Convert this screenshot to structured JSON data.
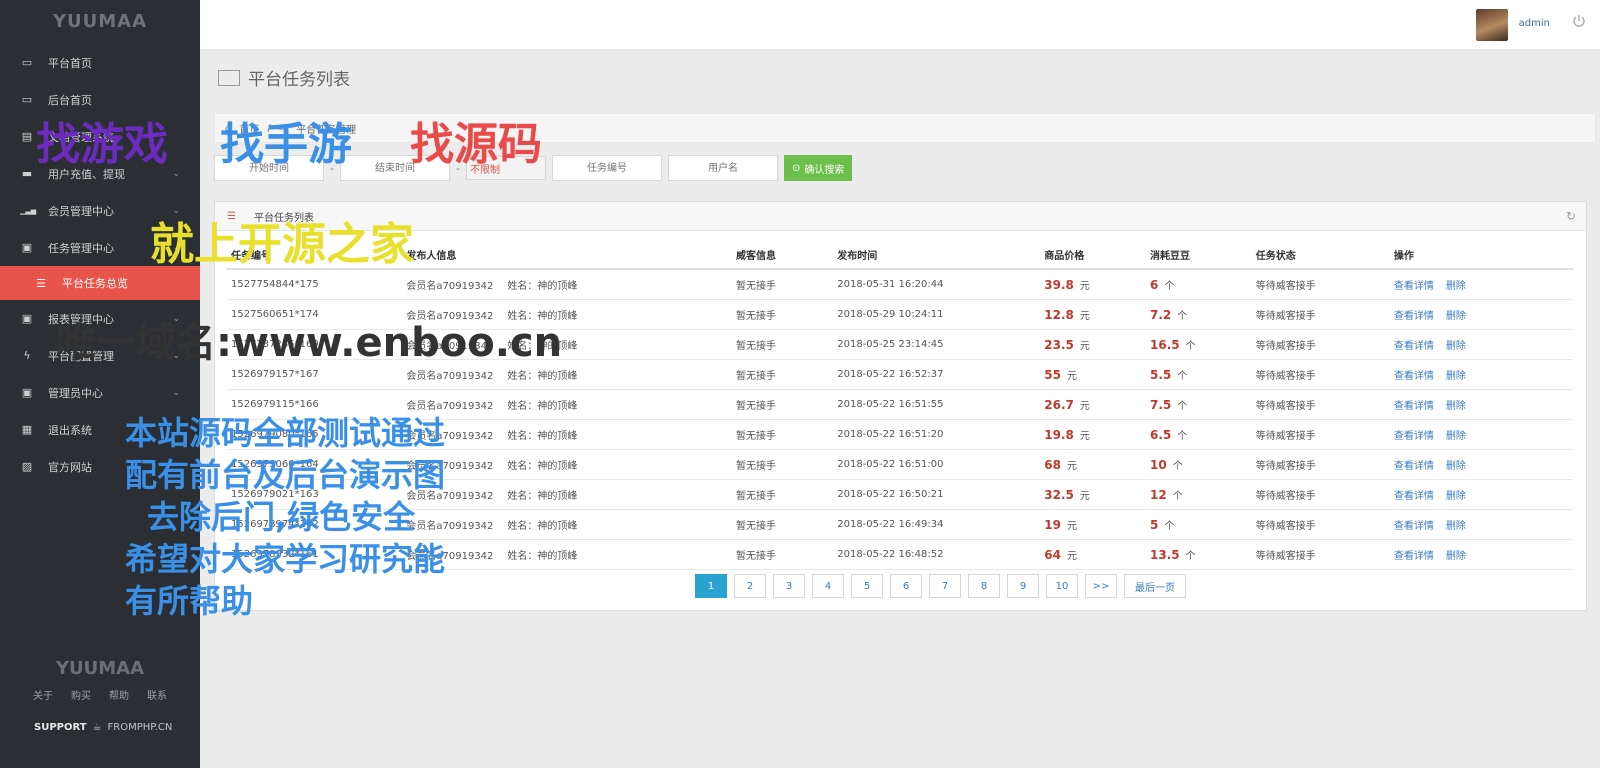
{
  "sidebar": {
    "brand": "YUUMAA",
    "items": [
      {
        "label": "平台首页",
        "icon": "laptop-icon"
      },
      {
        "label": "后台首页",
        "icon": "laptop-icon"
      },
      {
        "label": "文档管理系统",
        "icon": "doc-icon"
      },
      {
        "label": "用户充值、提现",
        "icon": "card-icon"
      },
      {
        "label": "会员管理中心",
        "icon": "signal-icon"
      },
      {
        "label": "任务管理中心",
        "icon": "briefcase-icon"
      },
      {
        "label": "平台任务总览",
        "icon": "list-icon",
        "active": true
      },
      {
        "label": "报表管理中心",
        "icon": "briefcase-icon"
      },
      {
        "label": "平台配置管理",
        "icon": "bolt-icon"
      },
      {
        "label": "管理员中心",
        "icon": "briefcase-icon"
      },
      {
        "label": "退出系统",
        "icon": "calendar-icon"
      },
      {
        "label": "官方网站",
        "icon": "image-icon"
      }
    ],
    "footer": {
      "brand": "YUUMAA",
      "links": [
        "关于",
        "购买",
        "帮助",
        "联系"
      ],
      "support_label": "SUPPORT",
      "support_site": "FROMPHP.CN"
    }
  },
  "topbar": {
    "username": "admin"
  },
  "page": {
    "title": "平台任务列表",
    "breadcrumb": [
      "首页",
      "平台任务管理"
    ]
  },
  "filters": {
    "start_placeholder": "开始时间",
    "end_placeholder": "结束时间",
    "select_value": "不限制",
    "task_no_placeholder": "任务编号",
    "username_placeholder": "用户名",
    "search_label": "确认搜索",
    "dash": "-"
  },
  "panel": {
    "title": "平台任务列表",
    "columns": [
      "任务编号",
      "发布人信息",
      "威客信息",
      "发布时间",
      "商品价格",
      "消耗豆豆",
      "任务状态",
      "操作"
    ],
    "rows": [
      {
        "id": "1527754844*175",
        "publisher": "会员名a70919342",
        "name": "姓名：神的顶峰",
        "worker": "暂无接手",
        "time": "2018-05-31 16:20:44",
        "price": "39.8",
        "price_unit": "元",
        "beans": "6",
        "beans_unit": "个",
        "status": "等待威客接手",
        "view": "查看详情",
        "del": "删除"
      },
      {
        "id": "1527560651*174",
        "publisher": "会员名a70919342",
        "name": "姓名：神的顶峰",
        "worker": "暂无接手",
        "time": "2018-05-29 10:24:11",
        "price": "12.8",
        "price_unit": "元",
        "beans": "7.2",
        "beans_unit": "个",
        "status": "等待威客接手",
        "view": "查看详情",
        "del": "删除"
      },
      {
        "id": "1527237285*169",
        "publisher": "会员名a70919342",
        "name": "姓名：神的顶峰",
        "worker": "暂无接手",
        "time": "2018-05-25 23:14:45",
        "price": "23.5",
        "price_unit": "元",
        "beans": "16.5",
        "beans_unit": "个",
        "status": "等待威客接手",
        "view": "查看详情",
        "del": "删除"
      },
      {
        "id": "1526979157*167",
        "publisher": "会员名a70919342",
        "name": "姓名：神的顶峰",
        "worker": "暂无接手",
        "time": "2018-05-22 16:52:37",
        "price": "55",
        "price_unit": "元",
        "beans": "5.5",
        "beans_unit": "个",
        "status": "等待威客接手",
        "view": "查看详情",
        "del": "删除"
      },
      {
        "id": "1526979115*166",
        "publisher": "会员名a70919342",
        "name": "姓名：神的顶峰",
        "worker": "暂无接手",
        "time": "2018-05-22 16:51:55",
        "price": "26.7",
        "price_unit": "元",
        "beans": "7.5",
        "beans_unit": "个",
        "status": "等待威客接手",
        "view": "查看详情",
        "del": "删除"
      },
      {
        "id": "1526979080*165",
        "publisher": "会员名a70919342",
        "name": "姓名：神的顶峰",
        "worker": "暂无接手",
        "time": "2018-05-22 16:51:20",
        "price": "19.8",
        "price_unit": "元",
        "beans": "6.5",
        "beans_unit": "个",
        "status": "等待威客接手",
        "view": "查看详情",
        "del": "删除"
      },
      {
        "id": "1526979060*164",
        "publisher": "会员名a70919342",
        "name": "姓名：神的顶峰",
        "worker": "暂无接手",
        "time": "2018-05-22 16:51:00",
        "price": "68",
        "price_unit": "元",
        "beans": "10",
        "beans_unit": "个",
        "status": "等待威客接手",
        "view": "查看详情",
        "del": "删除"
      },
      {
        "id": "1526979021*163",
        "publisher": "会员名a70919342",
        "name": "姓名：神的顶峰",
        "worker": "暂无接手",
        "time": "2018-05-22 16:50:21",
        "price": "32.5",
        "price_unit": "元",
        "beans": "12",
        "beans_unit": "个",
        "status": "等待威客接手",
        "view": "查看详情",
        "del": "删除"
      },
      {
        "id": "1526978974*162",
        "publisher": "会员名a70919342",
        "name": "姓名：神的顶峰",
        "worker": "暂无接手",
        "time": "2018-05-22 16:49:34",
        "price": "19",
        "price_unit": "元",
        "beans": "5",
        "beans_unit": "个",
        "status": "等待威客接手",
        "view": "查看详情",
        "del": "删除"
      },
      {
        "id": "1526978932*161",
        "publisher": "会员名a70919342",
        "name": "姓名：神的顶峰",
        "worker": "暂无接手",
        "time": "2018-05-22 16:48:52",
        "price": "64",
        "price_unit": "元",
        "beans": "13.5",
        "beans_unit": "个",
        "status": "等待威客接手",
        "view": "查看详情",
        "del": "删除"
      }
    ]
  },
  "pagination": {
    "pages": [
      "1",
      "2",
      "3",
      "4",
      "5",
      "6",
      "7",
      "8",
      "9",
      "10"
    ],
    "next": ">>",
    "last": "最后一页",
    "active": "1"
  },
  "watermark": {
    "line1": "找游戏",
    "line2": "找手游",
    "line3": "找源码",
    "line4": "就上开源之家",
    "line5": "唯一域名:www.enboo.cn",
    "lines6": [
      "本站源码全部测试通过",
      "配有前台及后台演示图",
      "去除后门,绿色安全",
      "希望对大家学习研究能",
      "有所帮助"
    ]
  }
}
